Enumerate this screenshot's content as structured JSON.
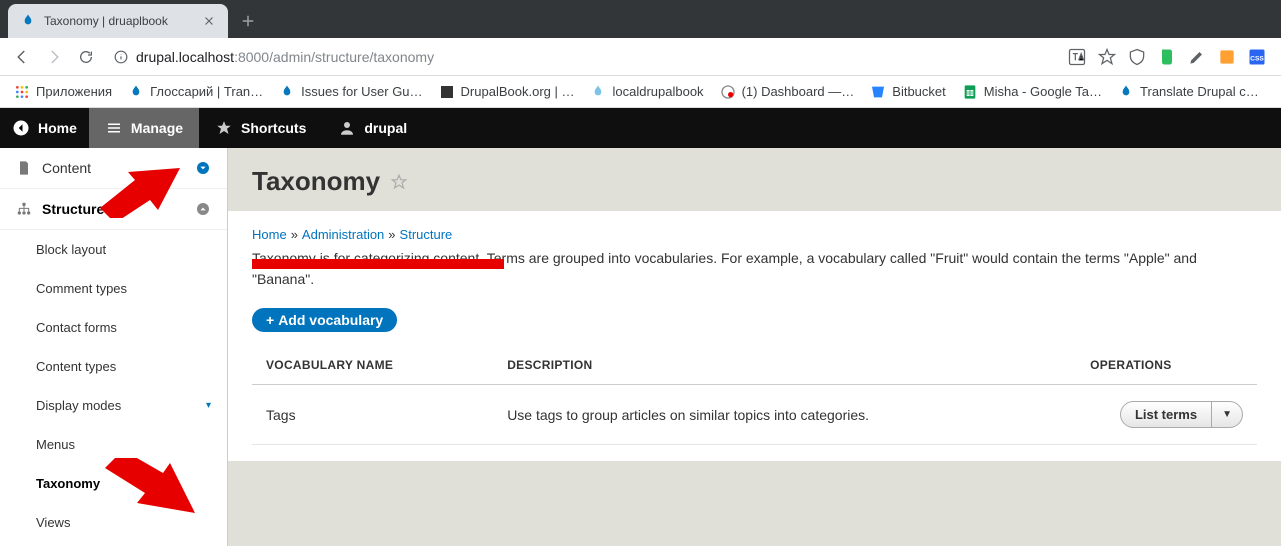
{
  "browser": {
    "tab_title": "Taxonomy | druaplbook",
    "url_host": "drupal.localhost",
    "url_port": ":8000",
    "url_path": "/admin/structure/taxonomy"
  },
  "bookmarks": [
    {
      "label": "Приложения",
      "icon": "apps"
    },
    {
      "label": "Глоссарий | Tran…",
      "icon": "drupal"
    },
    {
      "label": "Issues for User Gu…",
      "icon": "drupal"
    },
    {
      "label": "DrupalBook.org | …",
      "icon": "db"
    },
    {
      "label": "localdrupalbook",
      "icon": "drupal-lt"
    },
    {
      "label": "(1) Dashboard —…",
      "icon": "dash"
    },
    {
      "label": "Bitbucket",
      "icon": "bb"
    },
    {
      "label": "Misha - Google Ta…",
      "icon": "sheets"
    },
    {
      "label": "Translate Drupal c…",
      "icon": "drupal"
    }
  ],
  "toolbar": {
    "home": "Home",
    "manage": "Manage",
    "shortcuts": "Shortcuts",
    "user": "drupal"
  },
  "sidebar": {
    "content": "Content",
    "structure": "Structure",
    "items": [
      "Block layout",
      "Comment types",
      "Contact forms",
      "Content types",
      "Display modes",
      "Menus",
      "Taxonomy",
      "Views"
    ]
  },
  "page": {
    "title": "Taxonomy",
    "breadcrumb": {
      "home": "Home",
      "admin": "Administration",
      "structure": "Structure"
    },
    "description": "Taxonomy is for categorizing content. Terms are grouped into vocabularies. For example, a vocabulary called \"Fruit\" would contain the terms \"Apple\" and \"Banana\".",
    "add_button": "Add vocabulary",
    "table": {
      "headers": {
        "name": "VOCABULARY NAME",
        "desc": "DESCRIPTION",
        "ops": "OPERATIONS"
      },
      "rows": [
        {
          "name": "Tags",
          "desc": "Use tags to group articles on similar topics into categories.",
          "op": "List terms"
        }
      ]
    }
  }
}
